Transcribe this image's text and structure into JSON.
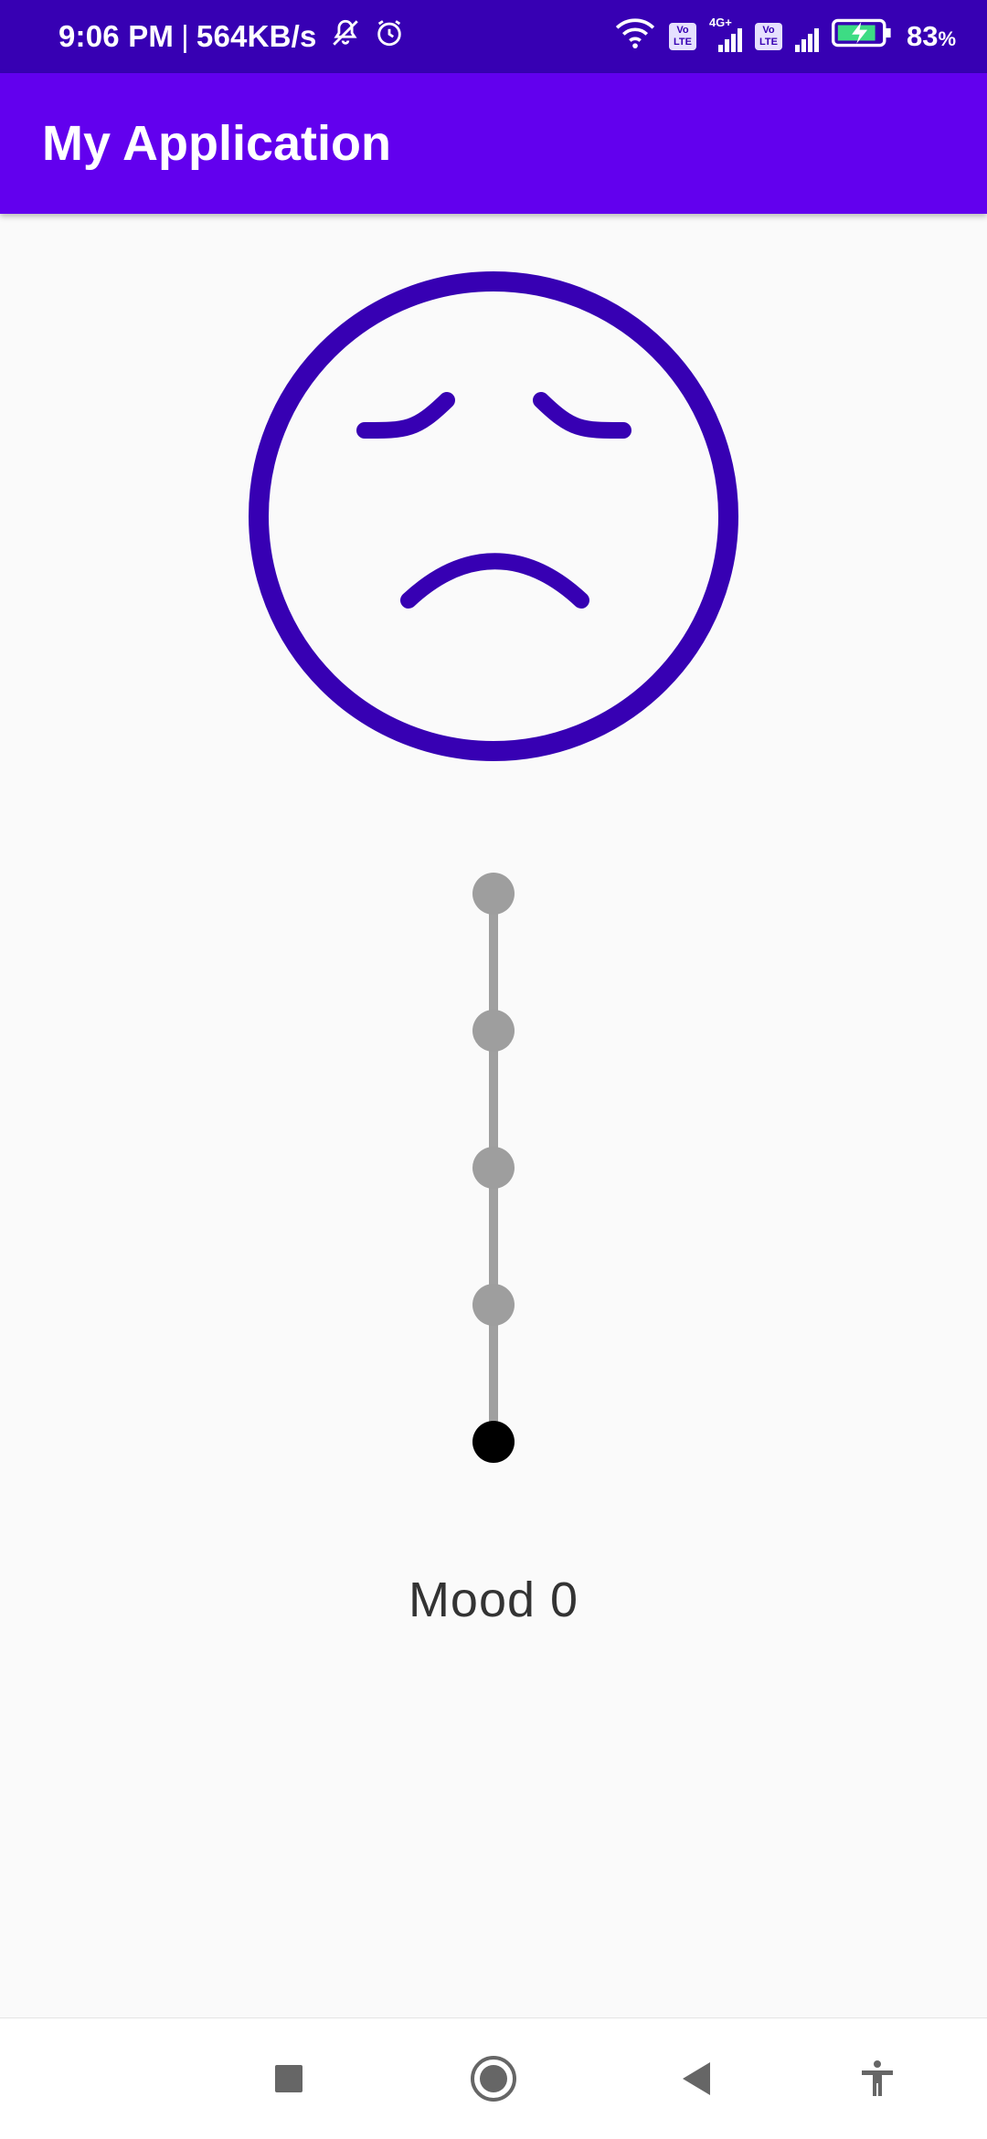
{
  "status_bar": {
    "time": "9:06 PM",
    "separator": "|",
    "speed": "564KB/s",
    "network_4g": "4G+",
    "volte": "Vo LTE",
    "battery": "83",
    "battery_unit": "%",
    "icons": [
      "bell-off-icon",
      "alarm-icon",
      "wifi-icon",
      "volte-icon",
      "signal-icon",
      "battery-charging-icon"
    ]
  },
  "app_bar": {
    "title": "My Application",
    "color": "#6200ee"
  },
  "face": {
    "expression": "sad",
    "color": "#3700b3"
  },
  "slider": {
    "orientation": "vertical",
    "steps": 5,
    "value": 0,
    "max": 4
  },
  "mood": {
    "label": "Mood 0"
  },
  "nav_bar": {
    "buttons": [
      "recents-button",
      "home-button",
      "back-button",
      "accessibility-button"
    ]
  }
}
